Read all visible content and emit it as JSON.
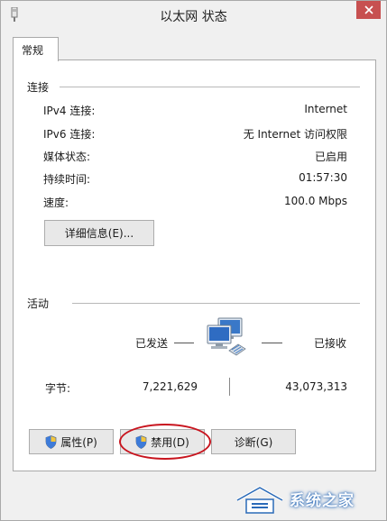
{
  "window": {
    "title": "以太网 状态"
  },
  "tabs": [
    {
      "label": "常规"
    }
  ],
  "connection": {
    "heading": "连接",
    "rows": [
      {
        "label": "IPv4 连接:",
        "value": "Internet"
      },
      {
        "label": "IPv6 连接:",
        "value": "无 Internet 访问权限"
      },
      {
        "label": "媒体状态:",
        "value": "已启用"
      },
      {
        "label": "持续时间:",
        "value": "01:57:30"
      },
      {
        "label": "速度:",
        "value": "100.0 Mbps"
      }
    ],
    "details_button": "详细信息(E)..."
  },
  "activity": {
    "heading": "活动",
    "sent_label": "已发送",
    "received_label": "已接收",
    "bytes_label": "字节:",
    "bytes_sent": "7,221,629",
    "bytes_received": "43,073,313"
  },
  "buttons": {
    "properties": "属性(P)",
    "disable": "禁用(D)",
    "diagnose": "诊断(G)"
  },
  "icons": {
    "app": "network-adapter-icon",
    "close": "close-icon",
    "shield": "uac-shield-icon",
    "network": "network-computers-icon"
  },
  "colors": {
    "close_button": "#c75050",
    "highlight": "#c8141e",
    "panel_bg": "#ffffff",
    "window_bg": "#f0f0f0"
  },
  "watermark": {
    "text": "系统之家"
  }
}
